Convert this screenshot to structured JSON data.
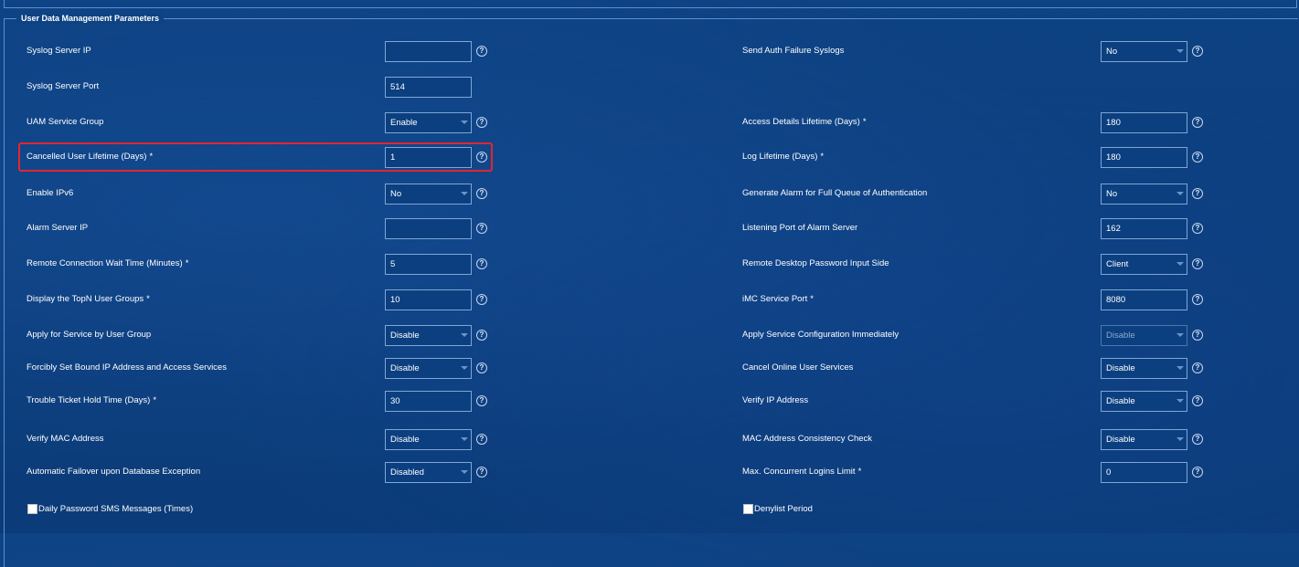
{
  "section_title": "User Data Management Parameters",
  "left": [
    {
      "label": "Syslog Server IP",
      "required": false,
      "kind": "text",
      "value": "",
      "help": true
    },
    {
      "label": "Syslog Server Port",
      "required": false,
      "kind": "text",
      "value": "514",
      "help": false
    },
    {
      "label": "UAM Service Group",
      "required": false,
      "kind": "select",
      "value": "Enable",
      "help": true
    },
    {
      "label": "Cancelled User Lifetime (Days)",
      "required": true,
      "kind": "text",
      "value": "1",
      "help": true
    },
    {
      "label": "Enable IPv6",
      "required": false,
      "kind": "select",
      "value": "No",
      "help": true
    },
    {
      "label": "Alarm Server IP",
      "required": false,
      "kind": "text",
      "value": "",
      "help": true
    },
    {
      "label": "Remote Connection Wait Time (Minutes)",
      "required": true,
      "kind": "text",
      "value": "5",
      "help": true
    },
    {
      "label": "Display the TopN User Groups",
      "required": true,
      "kind": "text",
      "value": "10",
      "help": true
    },
    {
      "label": "Apply for Service by User Group",
      "required": false,
      "kind": "select",
      "value": "Disable",
      "help": true
    },
    {
      "label": "Forcibly Set Bound IP Address and Access Services",
      "required": false,
      "kind": "select",
      "value": "Disable",
      "help": true
    },
    {
      "label": "Trouble Ticket Hold Time (Days)",
      "required": true,
      "kind": "text",
      "value": "30",
      "help": true
    },
    {
      "label": "Verify MAC Address",
      "required": false,
      "kind": "select",
      "value": "Disable",
      "help": true
    },
    {
      "label": "Automatic Failover upon Database Exception",
      "required": false,
      "kind": "select",
      "value": "Disabled",
      "help": true
    }
  ],
  "right": [
    {
      "label": "Send Auth Failure Syslogs",
      "required": false,
      "kind": "select",
      "value": "No",
      "help": true
    },
    null,
    {
      "label": "Access Details Lifetime (Days)",
      "required": true,
      "kind": "text",
      "value": "180",
      "help": true
    },
    {
      "label": "Log Lifetime (Days)",
      "required": true,
      "kind": "text",
      "value": "180",
      "help": true
    },
    {
      "label": "Generate Alarm for Full Queue of Authentication",
      "required": false,
      "kind": "select",
      "value": "No",
      "help": true
    },
    {
      "label": "Listening Port of Alarm Server",
      "required": false,
      "kind": "text",
      "value": "162",
      "help": true
    },
    {
      "label": "Remote Desktop Password Input Side",
      "required": false,
      "kind": "select",
      "value": "Client",
      "help": true
    },
    {
      "label": "iMC Service Port",
      "required": true,
      "kind": "text",
      "value": "8080",
      "help": true
    },
    {
      "label": "Apply Service Configuration Immediately",
      "required": false,
      "kind": "select",
      "value": "Disable",
      "disabled": true,
      "help": true
    },
    {
      "label": "Cancel Online User Services",
      "required": false,
      "kind": "select",
      "value": "Disable",
      "help": true
    },
    {
      "label": "Verify IP Address",
      "required": false,
      "kind": "select",
      "value": "Disable",
      "help": true
    },
    {
      "label": "MAC Address Consistency Check",
      "required": false,
      "kind": "select",
      "value": "Disable",
      "help": true
    },
    {
      "label": "Max. Concurrent Logins Limit",
      "required": true,
      "kind": "text",
      "value": "0",
      "help": true
    }
  ],
  "checkboxes": {
    "left": {
      "label": "Daily Password SMS Messages (Times)",
      "checked": false
    },
    "right": {
      "label": "Denylist Period",
      "checked": false
    }
  },
  "required_mark": "*",
  "help_glyph": "?"
}
